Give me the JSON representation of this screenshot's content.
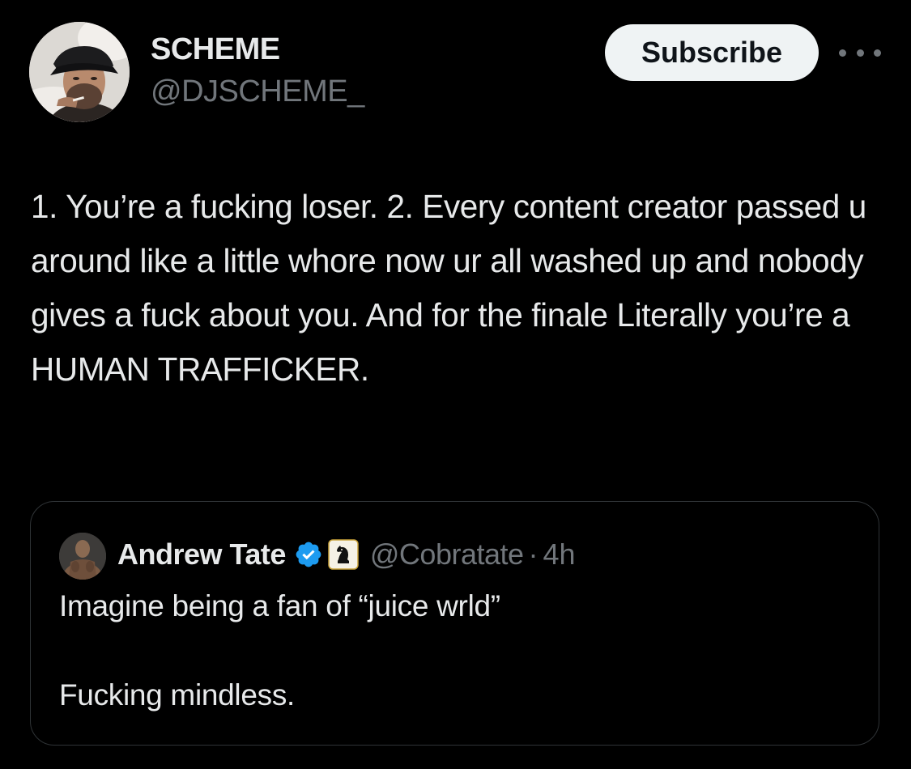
{
  "tweet": {
    "author": {
      "name": "SCHEME",
      "handle": "@DJSCHEME_",
      "avatar_icon": "user-photo-avatar"
    },
    "subscribe_label": "Subscribe",
    "more_icon": "more-horizontal-icon",
    "text": "1. You’re a fucking loser. 2. Every content creator passed u around like a little whore now ur all washed up and nobody gives a fuck about you. And for the finale Literally you’re a HUMAN TRAFFICKER."
  },
  "quote": {
    "author": {
      "name": "Andrew Tate",
      "handle": "@Cobratate",
      "separator": "·",
      "time": "4h",
      "verified_icon": "verified-badge-icon",
      "affiliate_icon": "chess-knight-affiliate-icon",
      "avatar_icon": "user-photo-avatar"
    },
    "text_lines": [
      "Imagine being a fan of “juice wrld”",
      "Fucking mindless."
    ]
  },
  "colors": {
    "background": "#000000",
    "primary_text": "#e7e9ea",
    "secondary_text": "#71767b",
    "border": "#2f3336",
    "verified_blue": "#1d9bf0",
    "button_bg": "#eff3f4"
  }
}
